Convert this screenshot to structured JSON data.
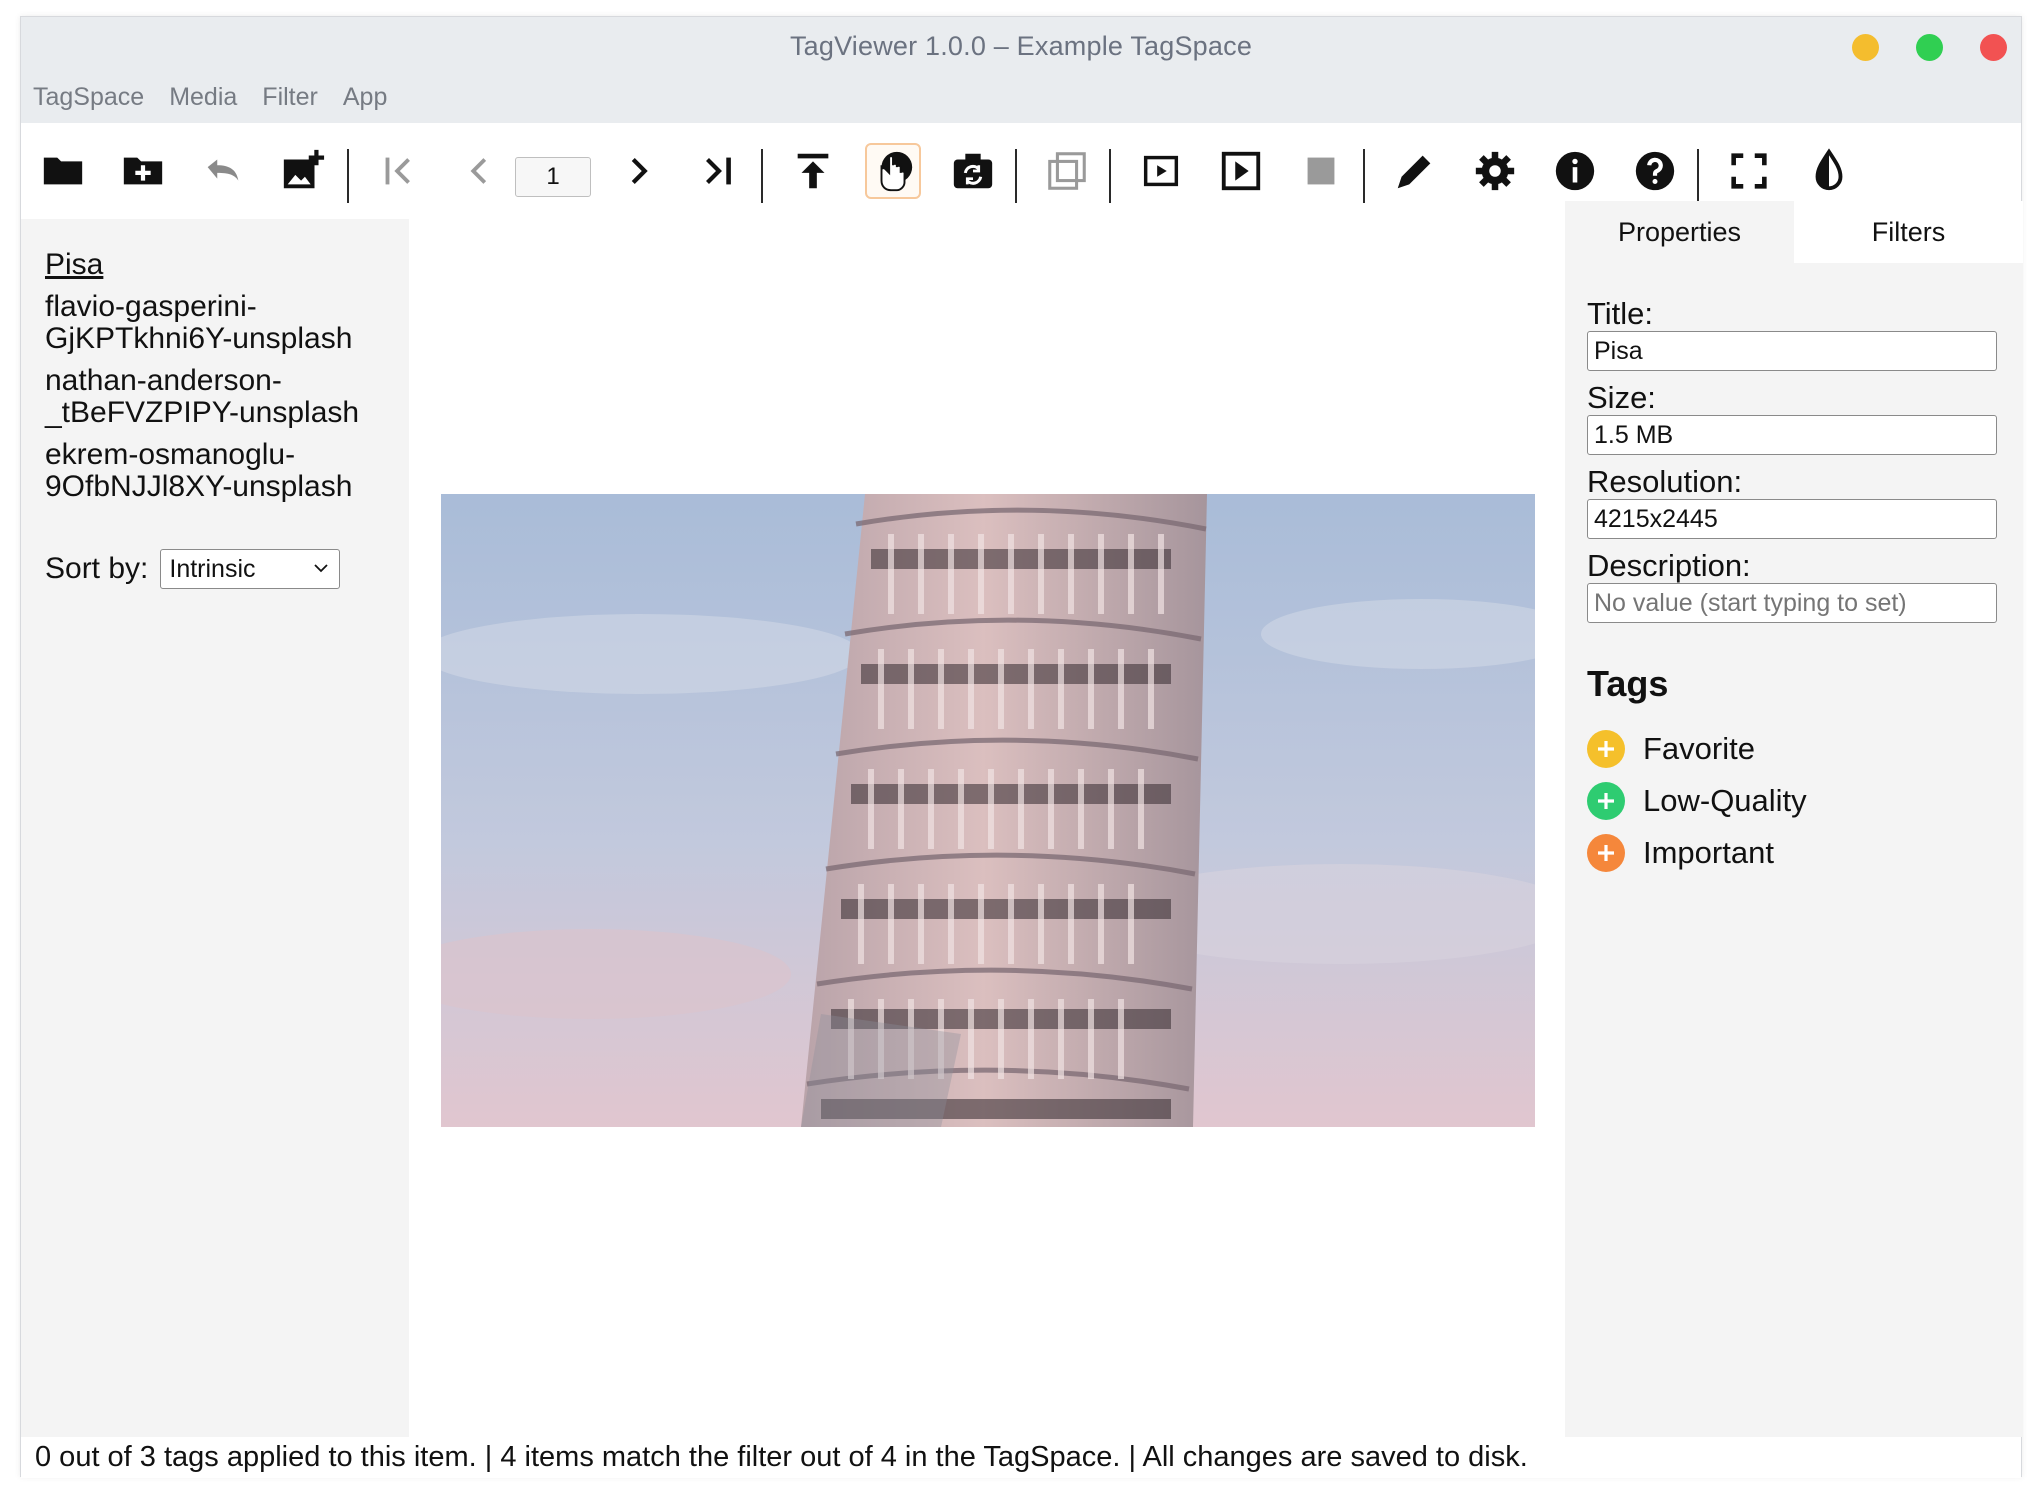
{
  "window": {
    "title": "TagViewer 1.0.0  –  Example TagSpace"
  },
  "menu": [
    "TagSpace",
    "Media",
    "Filter",
    "App"
  ],
  "toolbar": {
    "page_number": "1"
  },
  "sidebar": {
    "files": [
      "Pisa",
      "flavio-gasperini-GjKPTkhni6Y-unsplash",
      "nathan-anderson-_tBeFVZPIPY-unsplash",
      "ekrem-osmanoglu-9OfbNJJl8XY-unsplash"
    ],
    "sort_label": "Sort by:",
    "sort_value": "Intrinsic"
  },
  "tabs": [
    "Properties",
    "Filters"
  ],
  "properties": {
    "title_label": "Title:",
    "title_value": "Pisa",
    "size_label": "Size:",
    "size_value": "1.5 MB",
    "resolution_label": "Resolution:",
    "resolution_value": "4215x2445",
    "description_label": "Description:",
    "description_placeholder": "No value (start typing to set)"
  },
  "tags": {
    "heading": "Tags",
    "items": [
      {
        "label": "Favorite",
        "color": "#f5c02b"
      },
      {
        "label": "Low-Quality",
        "color": "#2ecc71"
      },
      {
        "label": "Important",
        "color": "#f5873b"
      }
    ]
  },
  "status": "0 out of 3 tags applied to this item.  |  4 items match the filter out of 4 in the TagSpace.  |  All changes are saved to disk.",
  "colors": {
    "titlebar_bg": "#e9ecef",
    "panel_bg": "#f4f4f4",
    "active_button_border": "#f7c89b"
  }
}
